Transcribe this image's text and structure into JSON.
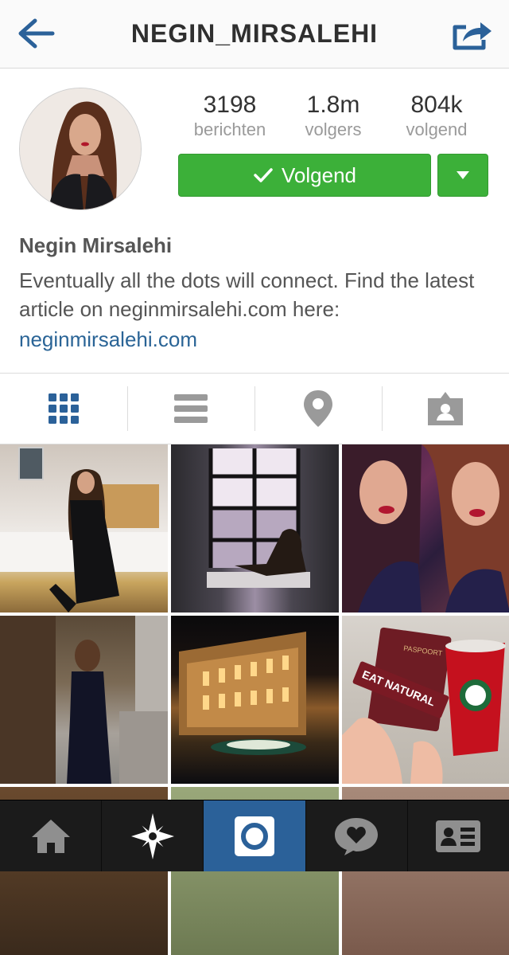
{
  "navbar": {
    "title": "NEGIN_MIRSALEHI",
    "back_icon": "back-arrow-icon",
    "share_icon": "share-icon"
  },
  "profile": {
    "stats": [
      {
        "value": "3198",
        "label": "berichten"
      },
      {
        "value": "1.8m",
        "label": "volgers"
      },
      {
        "value": "804k",
        "label": "volgend"
      }
    ],
    "follow_button_label": "Volgend",
    "name": "Negin Mirsalehi",
    "bio": "Eventually all the dots will connect. Find the latest article on neginmirsalehi.com here:",
    "website": "neginmirsalehi.com"
  },
  "view_tabs": [
    {
      "icon": "grid-view-icon",
      "active": true
    },
    {
      "icon": "list-view-icon",
      "active": false
    },
    {
      "icon": "location-pin-icon",
      "active": false
    },
    {
      "icon": "tagged-photos-icon",
      "active": false
    }
  ],
  "photo_overlay_text": {
    "passport": "PASPOORT",
    "bar": "EAT NATURAL"
  },
  "bottom_bar": [
    {
      "icon": "home-icon",
      "active": false
    },
    {
      "icon": "explore-icon",
      "active": false
    },
    {
      "icon": "camera-icon",
      "active": true
    },
    {
      "icon": "activity-heart-icon",
      "active": false
    },
    {
      "icon": "profile-card-icon",
      "active": false
    }
  ],
  "colors": {
    "accent_blue": "#2b6199",
    "follow_green": "#3cb039",
    "link_blue": "#2a6496",
    "bottom_bar_bg": "#1b1b1b"
  }
}
